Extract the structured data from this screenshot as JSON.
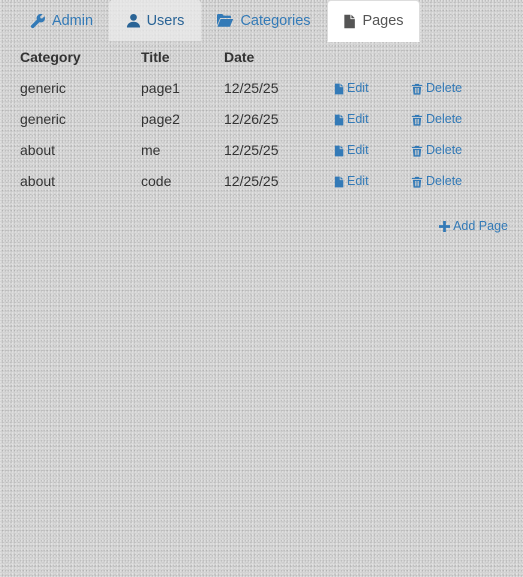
{
  "tabs": [
    {
      "label": "Admin",
      "icon": "wrench-icon"
    },
    {
      "label": "Users",
      "icon": "user-icon"
    },
    {
      "label": "Categories",
      "icon": "folder-open-icon"
    },
    {
      "label": "Pages",
      "icon": "file-icon"
    }
  ],
  "active_tab": "Pages",
  "table": {
    "headers": {
      "category": "Category",
      "title": "Title",
      "date": "Date"
    },
    "rows": [
      {
        "category": "generic",
        "title": "page1",
        "date": "12/25/25",
        "edit": "Edit",
        "delete": "Delete"
      },
      {
        "category": "generic",
        "title": "page2",
        "date": "12/26/25",
        "edit": "Edit",
        "delete": "Delete"
      },
      {
        "category": "about",
        "title": "me",
        "date": "12/25/25",
        "edit": "Edit",
        "delete": "Delete"
      },
      {
        "category": "about",
        "title": "code",
        "date": "12/25/25",
        "edit": "Edit",
        "delete": "Delete"
      }
    ]
  },
  "add_page_label": "Add Page",
  "colors": {
    "link": "#337ab7",
    "active_tab_bg": "#ffffff",
    "hover_tab_bg": "#ebebeb",
    "background": "#d2d2d2"
  }
}
